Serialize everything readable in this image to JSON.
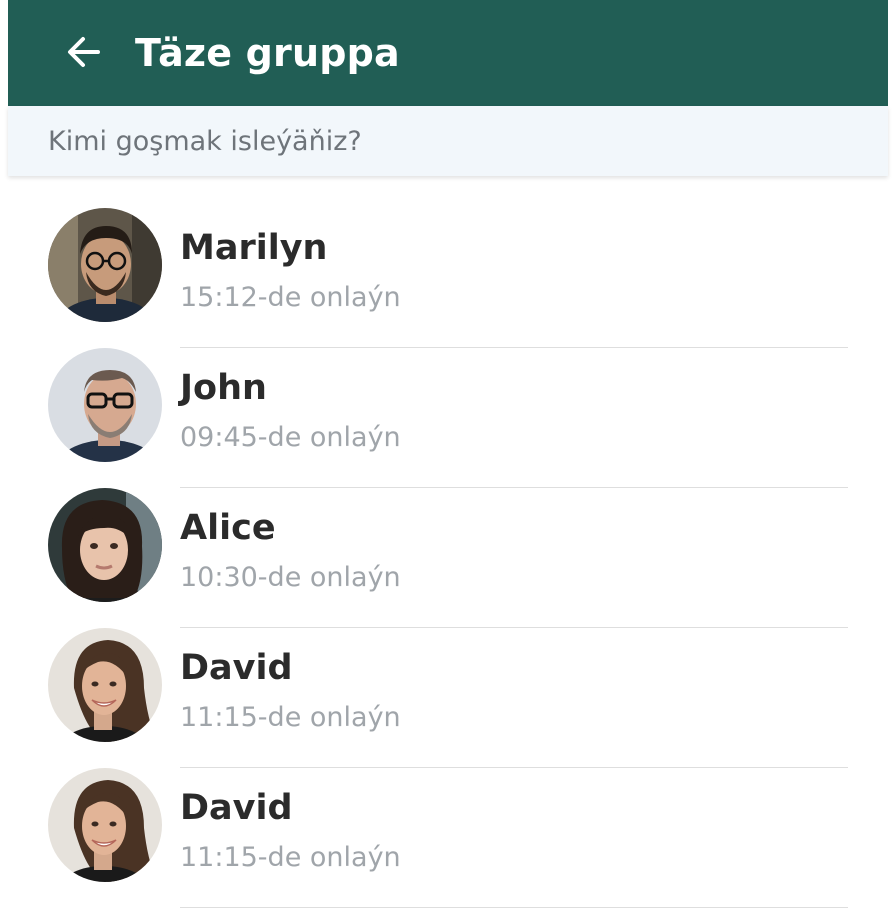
{
  "header": {
    "title": "Täze gruppa",
    "back_icon": "arrow-left-icon",
    "background": "#215e55"
  },
  "search": {
    "placeholder": "Kimi goşmak isleýäňiz?",
    "value": ""
  },
  "contacts": [
    {
      "name": "Marilyn",
      "status": "15:12-de onlaýn"
    },
    {
      "name": "John",
      "status": "09:45-de onlaýn"
    },
    {
      "name": "Alice",
      "status": "10:30-de onlaýn"
    },
    {
      "name": "David",
      "status": "11:15-de onlaýn"
    },
    {
      "name": "David",
      "status": "11:15-de onlaýn"
    }
  ]
}
